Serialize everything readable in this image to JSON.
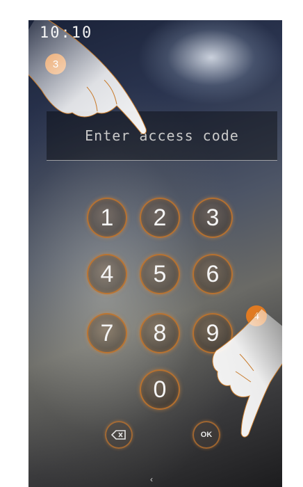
{
  "status_bar": {
    "time": "10:10"
  },
  "access_code": {
    "placeholder": "Enter access code"
  },
  "keypad": {
    "keys": [
      "1",
      "2",
      "3",
      "4",
      "5",
      "6",
      "7",
      "8",
      "9",
      "0"
    ],
    "ok_label": "OK"
  },
  "callouts": [
    "3",
    "4"
  ],
  "icons": {
    "backspace": "backspace-icon",
    "swipe": "chevron-up-icon",
    "finger": "pointing-finger-icon"
  },
  "colors": {
    "key_ring": "#c8782d",
    "callout_badge": "#e07a22",
    "text": "#f2f2f2"
  }
}
